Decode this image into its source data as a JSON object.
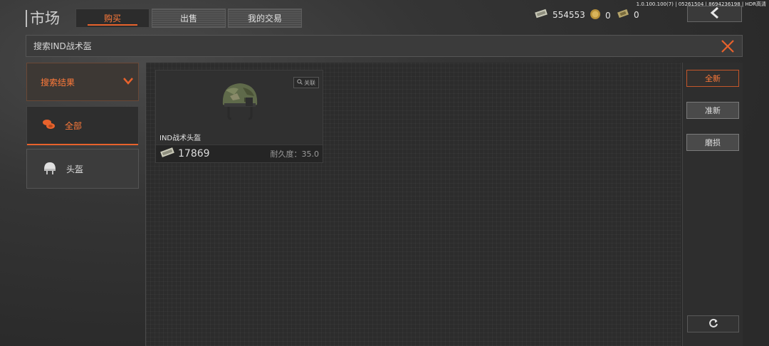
{
  "version_text": "1.0.100.100(7) | 05261504 | 8694236198 | HDR高清",
  "header": {
    "title": "市场",
    "tabs": [
      {
        "label": "购买",
        "active": true
      },
      {
        "label": "出售",
        "active": false
      },
      {
        "label": "我的交易",
        "active": false
      }
    ]
  },
  "currencies": [
    {
      "icon": "cash-icon",
      "value": "554553"
    },
    {
      "icon": "coin-icon",
      "value": "0"
    },
    {
      "icon": "voucher-icon",
      "value": "0"
    }
  ],
  "search": {
    "text": "搜索IND战术盔"
  },
  "sidebar": {
    "header_label": "搜索结果",
    "items": [
      {
        "label": "全部",
        "icon": "coins-stack-icon",
        "active": true
      },
      {
        "label": "头盔",
        "icon": "helmet-icon",
        "active": false
      }
    ]
  },
  "listing": {
    "name": "IND战术头盔",
    "price": "17869",
    "durability": "耐久度：35.0",
    "related_label": "关联"
  },
  "filters": [
    {
      "label": "全新",
      "active": true
    },
    {
      "label": "准新",
      "active": false
    },
    {
      "label": "磨损",
      "active": false
    }
  ],
  "colors": {
    "accent": "#e8622c",
    "accent_text": "#ff7a3a"
  }
}
